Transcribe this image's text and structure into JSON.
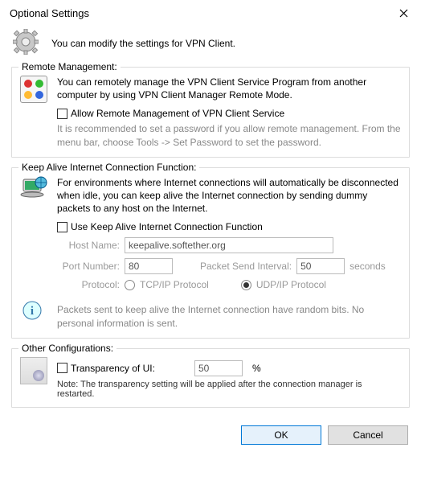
{
  "titlebar": {
    "title": "Optional Settings"
  },
  "header": {
    "text": "You can modify the settings for VPN Client."
  },
  "remote": {
    "title": "Remote Management:",
    "desc": "You can remotely manage the VPN Client Service Program from another computer by using VPN Client Manager Remote Mode.",
    "cb_label": "Allow Remote Management of VPN Client Service",
    "hint": "It is recommended to set a password if you allow remote management. From the menu bar, choose Tools -> Set Password to set the password."
  },
  "keepalive": {
    "title": "Keep Alive Internet Connection Function:",
    "desc": "For environments where Internet connections will automatically be disconnected when idle, you can keep alive the Internet connection by sending dummy packets to any host on the Internet.",
    "cb_label": "Use Keep Alive Internet Connection Function",
    "host_label": "Host Name:",
    "host_value": "keepalive.softether.org",
    "port_label": "Port Number:",
    "port_value": "80",
    "interval_label": "Packet Send Interval:",
    "interval_value": "50",
    "interval_unit": "seconds",
    "proto_label": "Protocol:",
    "proto_tcp": "TCP/IP Protocol",
    "proto_udp": "UDP/IP Protocol",
    "info": "Packets sent to keep alive the Internet connection have random bits. No personal information is sent."
  },
  "other": {
    "title": "Other Configurations:",
    "cb_label": "Transparency of UI:",
    "value": "50",
    "unit": "%",
    "note": "Note: The transparency setting will be applied after the connection manager is restarted."
  },
  "buttons": {
    "ok": "OK",
    "cancel": "Cancel"
  }
}
